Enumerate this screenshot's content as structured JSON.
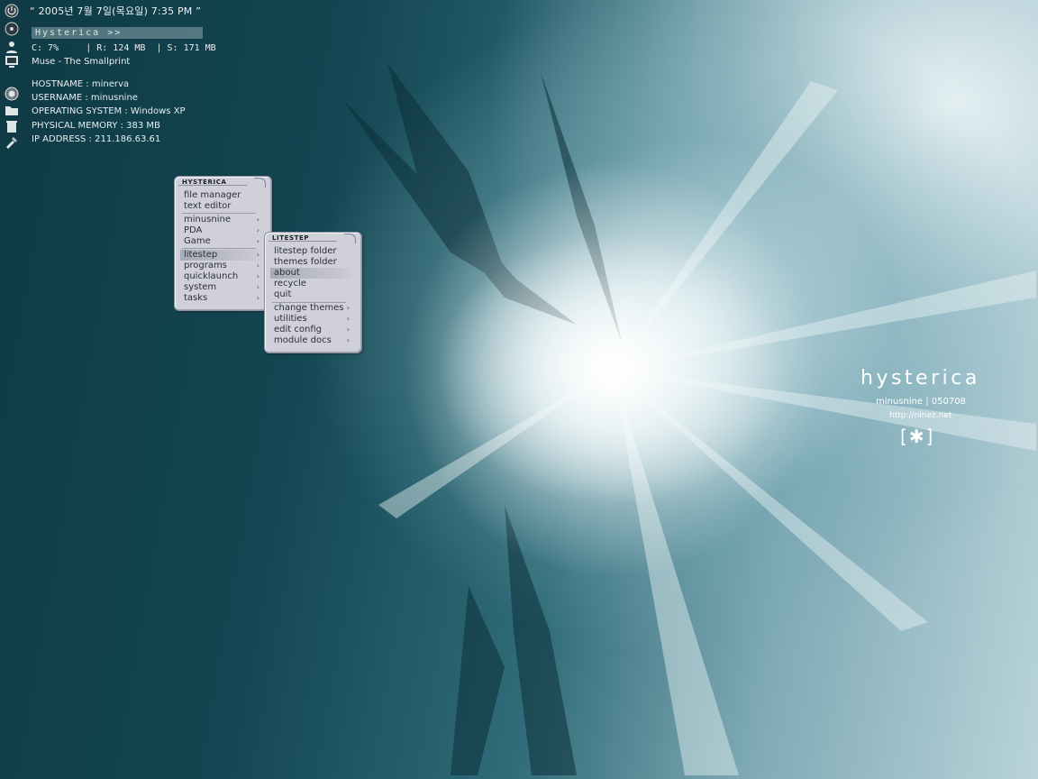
{
  "clock": {
    "datetime": "“ 2005년 7월 7일(목요일) 7:35 PM ”"
  },
  "run_box": {
    "label": "Hysterica >>"
  },
  "stats": {
    "line": "C: 7%     | R: 124 MB  | S: 171 MB"
  },
  "now_playing": {
    "track": "Muse - The Smallprint"
  },
  "system_info": {
    "hostname": "HOSTNAME : minerva",
    "username": "USERNAME : minusnine",
    "os": "OPERATING SYSTEM : Windows XP",
    "memory": "PHYSICAL MEMORY : 383 MB",
    "ip": "IP ADDRESS : 211.186.63.61"
  },
  "icon_strip": [
    "power-icon",
    "disc-icon",
    "user-icon",
    "monitor-icon",
    "firefox-icon",
    "folder-icon",
    "recycle-icon",
    "tools-icon"
  ],
  "menu_main": {
    "title": "HYSTERICA",
    "items": [
      {
        "label": "file manager",
        "submenu": false
      },
      {
        "label": "text editor",
        "submenu": false
      },
      {
        "label": "minusnine",
        "submenu": true
      },
      {
        "label": "PDA",
        "submenu": true
      },
      {
        "label": "Game",
        "submenu": true
      },
      {
        "label": "litestep",
        "submenu": true,
        "highlighted": true
      },
      {
        "label": "programs",
        "submenu": true
      },
      {
        "label": "quicklaunch",
        "submenu": true
      },
      {
        "label": "system",
        "submenu": true
      },
      {
        "label": "tasks",
        "submenu": true
      }
    ]
  },
  "menu_litestep": {
    "title": "LITESTEP",
    "items": [
      {
        "label": "litestep folder",
        "submenu": false
      },
      {
        "label": "themes folder",
        "submenu": false
      },
      {
        "label": "about",
        "submenu": false,
        "highlighted": true
      },
      {
        "label": "recycle",
        "submenu": false
      },
      {
        "label": "quit",
        "submenu": false
      },
      {
        "label": "change themes",
        "submenu": true
      },
      {
        "label": "utilities",
        "submenu": true
      },
      {
        "label": "edit config",
        "submenu": true
      },
      {
        "label": "module docs",
        "submenu": true
      }
    ]
  },
  "branding": {
    "title": "hysterica",
    "author": "minusnine | 050708",
    "url": "http://ninez.net",
    "logo": "[✱]"
  },
  "colors": {
    "menu_bg": "#cfd0da",
    "menu_text": "#2d2f38",
    "background_dark": "#134652",
    "background_light": "#b9d3da"
  }
}
